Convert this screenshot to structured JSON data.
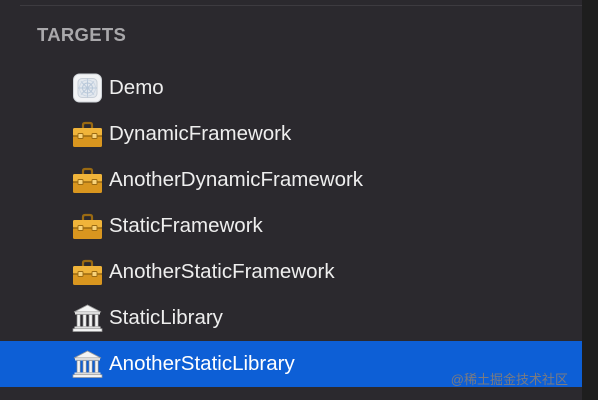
{
  "section": {
    "title": "TARGETS"
  },
  "targets": [
    {
      "label": "Demo",
      "icon": "app-icon",
      "selected": false
    },
    {
      "label": "DynamicFramework",
      "icon": "toolbox-icon",
      "selected": false
    },
    {
      "label": "AnotherDynamicFramework",
      "icon": "toolbox-icon",
      "selected": false
    },
    {
      "label": "StaticFramework",
      "icon": "toolbox-icon",
      "selected": false
    },
    {
      "label": "AnotherStaticFramework",
      "icon": "toolbox-icon",
      "selected": false
    },
    {
      "label": "StaticLibrary",
      "icon": "library-icon",
      "selected": false
    },
    {
      "label": "AnotherStaticLibrary",
      "icon": "library-icon",
      "selected": true
    }
  ],
  "watermark": "@稀土掘金技术社区",
  "colors": {
    "panel_background": "#2b292e",
    "selection": "#0d5fd6",
    "header_text": "#a9a8ab",
    "item_text": "#eeeeee",
    "toolbox": "#e8a92e"
  }
}
